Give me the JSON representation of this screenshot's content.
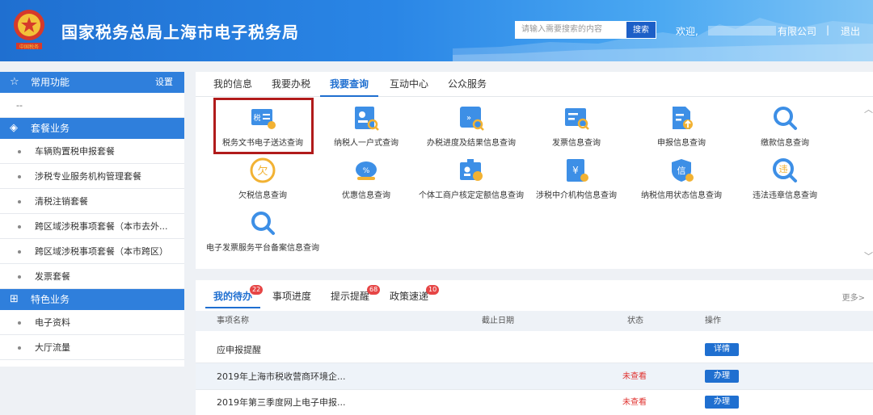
{
  "header": {
    "title": "国家税务总局上海市电子税务局",
    "search_placeholder": "请输入需要搜索的内容",
    "search_button": "搜索",
    "welcome": "欢迎,",
    "company_tail": "有限公司",
    "separator": "|",
    "logout": "退出"
  },
  "sidebar": {
    "common": {
      "title": "常用功能",
      "settings": "设置",
      "placeholder": "--"
    },
    "package": {
      "title": "套餐业务",
      "items": [
        "车辆购置税申报套餐",
        "涉税专业服务机构管理套餐",
        "清税注销套餐",
        "跨区域涉税事项套餐（本市去外...",
        "跨区域涉税事项套餐（本市跨区）",
        "发票套餐"
      ]
    },
    "special": {
      "title": "特色业务",
      "items": [
        "电子资料",
        "大厅流量"
      ]
    }
  },
  "main_tabs": [
    "我的信息",
    "我要办税",
    "我要查询",
    "互动中心",
    "公众服务"
  ],
  "services": [
    {
      "label": "税务文书电子送达查询",
      "icon": "tax-document-icon"
    },
    {
      "label": "纳税人一户式查询",
      "icon": "taxpayer-search-icon"
    },
    {
      "label": "办税进度及结果信息查询",
      "icon": "progress-search-icon"
    },
    {
      "label": "发票信息查询",
      "icon": "invoice-search-icon"
    },
    {
      "label": "申报信息查询",
      "icon": "declaration-upload-icon"
    },
    {
      "label": "缴款信息查询",
      "icon": "magnifier-icon"
    },
    {
      "label": "欠税信息查询",
      "icon": "arrears-icon"
    },
    {
      "label": "优惠信息查询",
      "icon": "discount-icon"
    },
    {
      "label": "个体工商户核定定额信息查询",
      "icon": "business-quota-icon"
    },
    {
      "label": "涉税中介机构信息查询",
      "icon": "agency-yuan-icon"
    },
    {
      "label": "纳税信用状态信息查询",
      "icon": "credit-shield-icon"
    },
    {
      "label": "违法违章信息查询",
      "icon": "violation-icon"
    },
    {
      "label": "电子发票服务平台备案信息查询",
      "icon": "magnifier-icon"
    }
  ],
  "todo": {
    "tabs": [
      {
        "label": "我的待办",
        "badge": "22"
      },
      {
        "label": "事项进度",
        "badge": ""
      },
      {
        "label": "提示提醒",
        "badge": "68"
      },
      {
        "label": "政策速递",
        "badge": "10"
      }
    ],
    "more": "更多>",
    "columns": [
      "事项名称",
      "截止日期",
      "状态",
      "操作"
    ],
    "rows": [
      {
        "name": "应申报提醒",
        "deadline": "",
        "status": "",
        "action": "详情"
      },
      {
        "name": "2019年上海市税收营商环境企...",
        "deadline": "",
        "status": "未查看",
        "action": "办理"
      },
      {
        "name": "2019年第三季度网上电子申报...",
        "deadline": "",
        "status": "未查看",
        "action": "办理"
      }
    ]
  },
  "colors": {
    "primary": "#1f6fd0",
    "highlight": "#b11b1b",
    "badge": "#e64545",
    "status_red": "#e0322f"
  }
}
